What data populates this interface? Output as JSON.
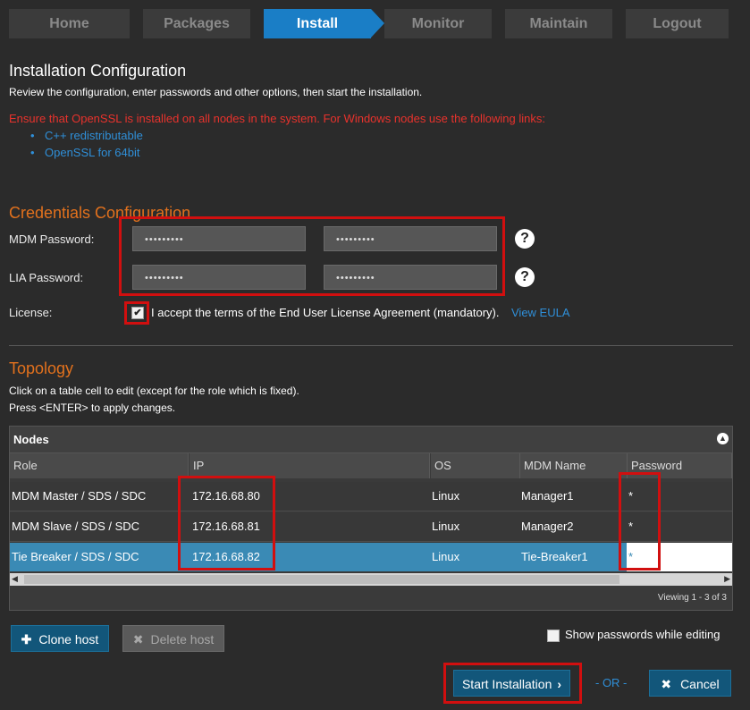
{
  "nav": {
    "items": [
      {
        "label": "Home"
      },
      {
        "label": "Packages"
      },
      {
        "label": "Install"
      },
      {
        "label": "Monitor"
      },
      {
        "label": "Maintain"
      },
      {
        "label": "Logout"
      }
    ],
    "active": "Install"
  },
  "header": {
    "title": "Installation Configuration",
    "subtitle": "Review the configuration, enter passwords and other options, then start the installation."
  },
  "notice": {
    "text": "Ensure that OpenSSL is installed on all nodes in the system. For Windows nodes use the following links:",
    "links": [
      "C++ redistributable",
      "OpenSSL for 64bit"
    ]
  },
  "credentials": {
    "title": "Credentials Configuration",
    "mdm_label": "MDM Password:",
    "mdm_password": "•••••••••",
    "mdm_confirm": "•••••••••",
    "lia_label": "LIA Password:",
    "lia_password": "•••••••••",
    "lia_confirm": "•••••••••",
    "help_symbol": "?",
    "license_label": "License:",
    "license_text": "I accept the terms of the End User License Agreement (mandatory).",
    "license_checked": true,
    "eula_link": "View EULA"
  },
  "topology": {
    "title": "Topology",
    "instructions_1": "Click on a table cell to edit (except for the role which is fixed).",
    "instructions_2": "Press <ENTER> to apply changes."
  },
  "table": {
    "caption": "Nodes",
    "columns": [
      "Role",
      "IP",
      "OS",
      "MDM Name",
      "Password"
    ],
    "rows": [
      {
        "role": "MDM Master / SDS / SDC",
        "ip": "172.16.68.80",
        "os": "Linux",
        "name": "Manager1",
        "password": "*"
      },
      {
        "role": "MDM Slave / SDS / SDC",
        "ip": "172.16.68.81",
        "os": "Linux",
        "name": "Manager2",
        "password": "*"
      },
      {
        "role": "Tie Breaker / SDS / SDC",
        "ip": "172.16.68.82",
        "os": "Linux",
        "name": "Tie-Breaker1",
        "password": "*"
      }
    ],
    "selected_row": 2,
    "footer": "Viewing 1 - 3 of 3"
  },
  "actions": {
    "clone": "Clone host",
    "delete": "Delete host",
    "show_passwords": "Show passwords while editing",
    "show_passwords_checked": false,
    "start": "Start Installation",
    "or": "- OR -",
    "cancel": "Cancel"
  },
  "colors": {
    "accent": "#1a7ec6",
    "section": "#e2711d",
    "warning": "#e8322c",
    "highlight": "#d10f0f",
    "selected_row": "#3a8ab5",
    "primary_button": "#12567a"
  }
}
